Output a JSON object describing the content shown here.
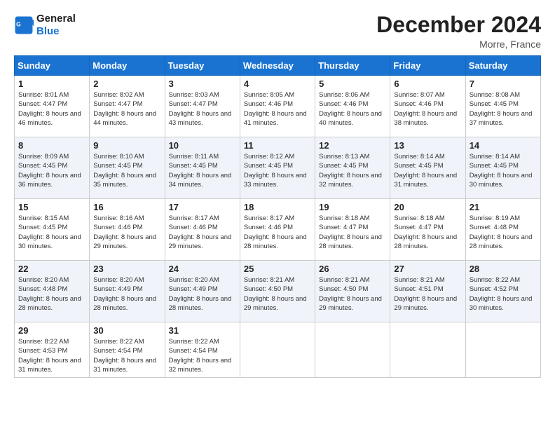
{
  "logo": {
    "line1": "General",
    "line2": "Blue"
  },
  "title": "December 2024",
  "location": "Morre, France",
  "weekdays": [
    "Sunday",
    "Monday",
    "Tuesday",
    "Wednesday",
    "Thursday",
    "Friday",
    "Saturday"
  ],
  "weeks": [
    [
      {
        "day": "1",
        "sunrise": "8:01 AM",
        "sunset": "4:47 PM",
        "daylight": "8 hours and 46 minutes."
      },
      {
        "day": "2",
        "sunrise": "8:02 AM",
        "sunset": "4:47 PM",
        "daylight": "8 hours and 44 minutes."
      },
      {
        "day": "3",
        "sunrise": "8:03 AM",
        "sunset": "4:47 PM",
        "daylight": "8 hours and 43 minutes."
      },
      {
        "day": "4",
        "sunrise": "8:05 AM",
        "sunset": "4:46 PM",
        "daylight": "8 hours and 41 minutes."
      },
      {
        "day": "5",
        "sunrise": "8:06 AM",
        "sunset": "4:46 PM",
        "daylight": "8 hours and 40 minutes."
      },
      {
        "day": "6",
        "sunrise": "8:07 AM",
        "sunset": "4:46 PM",
        "daylight": "8 hours and 38 minutes."
      },
      {
        "day": "7",
        "sunrise": "8:08 AM",
        "sunset": "4:45 PM",
        "daylight": "8 hours and 37 minutes."
      }
    ],
    [
      {
        "day": "8",
        "sunrise": "8:09 AM",
        "sunset": "4:45 PM",
        "daylight": "8 hours and 36 minutes."
      },
      {
        "day": "9",
        "sunrise": "8:10 AM",
        "sunset": "4:45 PM",
        "daylight": "8 hours and 35 minutes."
      },
      {
        "day": "10",
        "sunrise": "8:11 AM",
        "sunset": "4:45 PM",
        "daylight": "8 hours and 34 minutes."
      },
      {
        "day": "11",
        "sunrise": "8:12 AM",
        "sunset": "4:45 PM",
        "daylight": "8 hours and 33 minutes."
      },
      {
        "day": "12",
        "sunrise": "8:13 AM",
        "sunset": "4:45 PM",
        "daylight": "8 hours and 32 minutes."
      },
      {
        "day": "13",
        "sunrise": "8:14 AM",
        "sunset": "4:45 PM",
        "daylight": "8 hours and 31 minutes."
      },
      {
        "day": "14",
        "sunrise": "8:14 AM",
        "sunset": "4:45 PM",
        "daylight": "8 hours and 30 minutes."
      }
    ],
    [
      {
        "day": "15",
        "sunrise": "8:15 AM",
        "sunset": "4:45 PM",
        "daylight": "8 hours and 30 minutes."
      },
      {
        "day": "16",
        "sunrise": "8:16 AM",
        "sunset": "4:46 PM",
        "daylight": "8 hours and 29 minutes."
      },
      {
        "day": "17",
        "sunrise": "8:17 AM",
        "sunset": "4:46 PM",
        "daylight": "8 hours and 29 minutes."
      },
      {
        "day": "18",
        "sunrise": "8:17 AM",
        "sunset": "4:46 PM",
        "daylight": "8 hours and 28 minutes."
      },
      {
        "day": "19",
        "sunrise": "8:18 AM",
        "sunset": "4:47 PM",
        "daylight": "8 hours and 28 minutes."
      },
      {
        "day": "20",
        "sunrise": "8:18 AM",
        "sunset": "4:47 PM",
        "daylight": "8 hours and 28 minutes."
      },
      {
        "day": "21",
        "sunrise": "8:19 AM",
        "sunset": "4:48 PM",
        "daylight": "8 hours and 28 minutes."
      }
    ],
    [
      {
        "day": "22",
        "sunrise": "8:20 AM",
        "sunset": "4:48 PM",
        "daylight": "8 hours and 28 minutes."
      },
      {
        "day": "23",
        "sunrise": "8:20 AM",
        "sunset": "4:49 PM",
        "daylight": "8 hours and 28 minutes."
      },
      {
        "day": "24",
        "sunrise": "8:20 AM",
        "sunset": "4:49 PM",
        "daylight": "8 hours and 28 minutes."
      },
      {
        "day": "25",
        "sunrise": "8:21 AM",
        "sunset": "4:50 PM",
        "daylight": "8 hours and 29 minutes."
      },
      {
        "day": "26",
        "sunrise": "8:21 AM",
        "sunset": "4:50 PM",
        "daylight": "8 hours and 29 minutes."
      },
      {
        "day": "27",
        "sunrise": "8:21 AM",
        "sunset": "4:51 PM",
        "daylight": "8 hours and 29 minutes."
      },
      {
        "day": "28",
        "sunrise": "8:22 AM",
        "sunset": "4:52 PM",
        "daylight": "8 hours and 30 minutes."
      }
    ],
    [
      {
        "day": "29",
        "sunrise": "8:22 AM",
        "sunset": "4:53 PM",
        "daylight": "8 hours and 31 minutes."
      },
      {
        "day": "30",
        "sunrise": "8:22 AM",
        "sunset": "4:54 PM",
        "daylight": "8 hours and 31 minutes."
      },
      {
        "day": "31",
        "sunrise": "8:22 AM",
        "sunset": "4:54 PM",
        "daylight": "8 hours and 32 minutes."
      },
      null,
      null,
      null,
      null
    ]
  ]
}
